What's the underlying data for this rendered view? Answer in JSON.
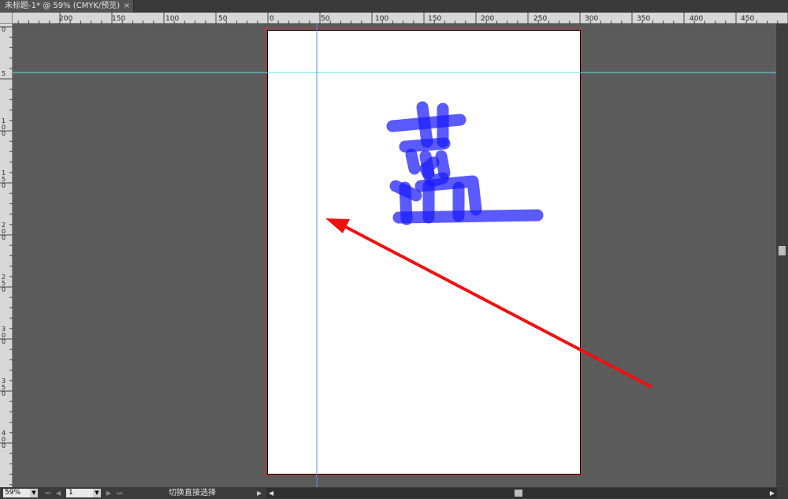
{
  "tab": {
    "title": "未标题-1* @ 59% (CMYK/预览)",
    "close": "×"
  },
  "hruler": {
    "labels": [
      "200",
      "150",
      "100",
      "50",
      "0",
      "50",
      "100",
      "150",
      "200",
      "250",
      "300",
      "350",
      "400",
      "450"
    ]
  },
  "vruler": {
    "labels": [
      "0",
      "5",
      "1 0 0",
      "1 5 0",
      "2 0 0",
      "2 5 0",
      "3 0 0",
      "3 5 0",
      "4 0 0"
    ]
  },
  "statusbar": {
    "zoom": "59%",
    "page": "1",
    "status_text": "切换直接选择",
    "nav_first": "⏮",
    "nav_prev": "◀",
    "nav_next": "▶",
    "nav_last": "⏭",
    "dropdown": "▼",
    "play": "▶"
  },
  "canvas": {
    "guide_color": "#66d9ef",
    "stroke_color": "#1a1aff",
    "arrow_color": "#ee1111"
  }
}
